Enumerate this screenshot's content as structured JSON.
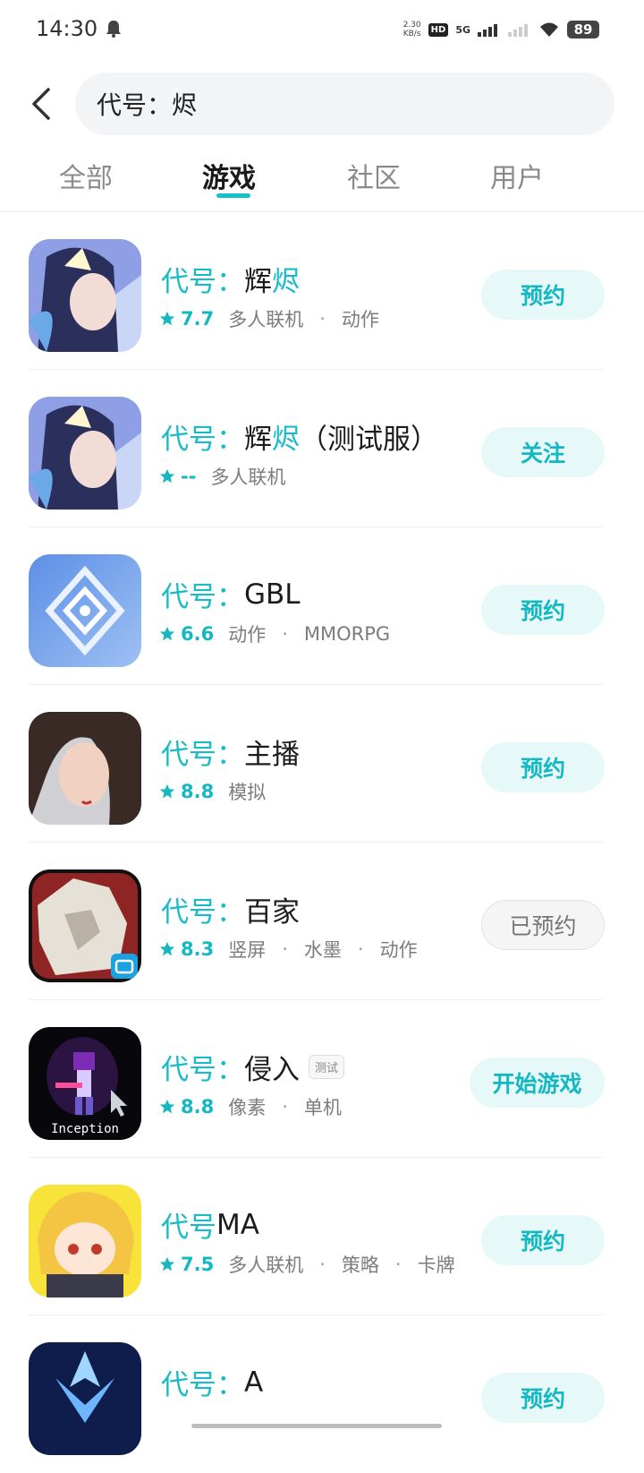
{
  "status_bar": {
    "time": "14:30",
    "net_speed_value": "2.30",
    "net_speed_unit": "KB/s",
    "hd_label": "HD",
    "network": "5G",
    "battery": "89"
  },
  "search": {
    "query": "代号：烬"
  },
  "tabs": [
    {
      "label": "全部",
      "active": false
    },
    {
      "label": "游戏",
      "active": true
    },
    {
      "label": "社区",
      "active": false
    },
    {
      "label": "用户",
      "active": false
    }
  ],
  "games": [
    {
      "name_prefix": "代号：",
      "name_main": "辉",
      "name_highlight": "烬",
      "name_suffix": "",
      "rating": "7.7",
      "tags": [
        "多人联机",
        "动作"
      ],
      "button": "预约"
    },
    {
      "name_prefix": "代号：",
      "name_main": "辉",
      "name_highlight": "烬",
      "name_suffix": "（测试服）",
      "rating": "--",
      "tags": [
        "多人联机"
      ],
      "button": "关注"
    },
    {
      "name_prefix": "代号：",
      "name_main": "GBL",
      "name_highlight": "",
      "name_suffix": "",
      "rating": "6.6",
      "tags": [
        "动作",
        "MMORPG"
      ],
      "button": "预约"
    },
    {
      "name_prefix": "代号：",
      "name_main": "主播",
      "name_highlight": "",
      "name_suffix": "",
      "rating": "8.8",
      "tags": [
        "模拟"
      ],
      "button": "预约"
    },
    {
      "name_prefix": "代号：",
      "name_main": "百家",
      "name_highlight": "",
      "name_suffix": "",
      "rating": "8.3",
      "tags": [
        "竖屏",
        "水墨",
        "动作"
      ],
      "button": "已预约"
    },
    {
      "name_prefix": "代号：",
      "name_main": "侵入",
      "name_highlight": "",
      "name_suffix": "",
      "tag_badge": "测试",
      "rating": "8.8",
      "tags": [
        "像素",
        "单机"
      ],
      "button": "开始游戏",
      "icon_caption": "Inception"
    },
    {
      "name_prefix": "代号",
      "name_main": "MA",
      "name_highlight": "",
      "name_suffix": "",
      "rating": "7.5",
      "tags": [
        "多人联机",
        "策略",
        "卡牌"
      ],
      "button": "预约"
    },
    {
      "name_prefix": "代号：",
      "name_main": "A",
      "name_highlight": "",
      "name_suffix": "",
      "rating": "",
      "tags": [],
      "button": "预约"
    }
  ],
  "colors": {
    "accent": "#14b8c2",
    "tab_text": "#8a8a8a",
    "button_bg": "#e7f8f9"
  }
}
